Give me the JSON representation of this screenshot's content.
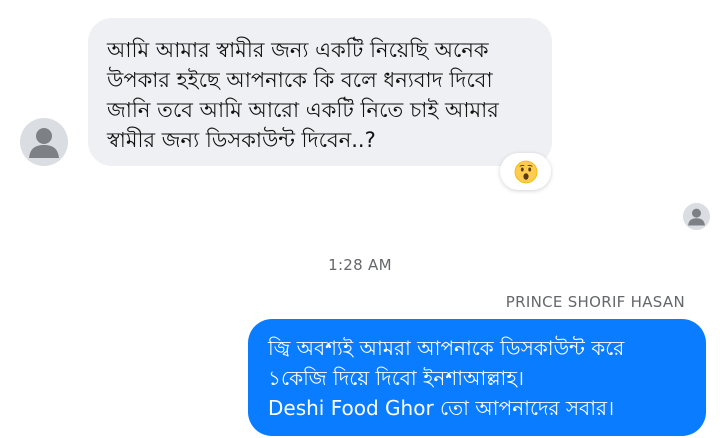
{
  "incoming_message": {
    "lines": [
      "আমি আমার স্বামীর জন্য একটি নিয়েছি অনেক",
      "উপকার হইছে আপনাকে কি বলে ধন্যবাদ দিবো",
      "জানি তবে আমি আরো একটি নিতে চাই আমার",
      "স্বামীর জন্য ডিসকাউন্ট দিবেন..?"
    ],
    "reaction": "😮",
    "reaction_icon": "surprised-face-emoji"
  },
  "timestamp": "1:28 AM",
  "outgoing_message": {
    "sender": "PRINCE SHORIF HASAN",
    "lines": [
      "জ্বি অবশ্যই আমরা আপনাকে ডিসকাউন্ট করে",
      "১কেজি দিয়ে দিবো ইনশাআল্লাহ।",
      "Deshi Food Ghor তো আপনাদের সবার।"
    ]
  },
  "colors": {
    "incoming_bubble": "#eef0f3",
    "outgoing_bubble": "#0a7cff",
    "meta_text": "#65676b",
    "avatar_bg": "#dadde1",
    "avatar_fg": "#bcc0c4"
  }
}
